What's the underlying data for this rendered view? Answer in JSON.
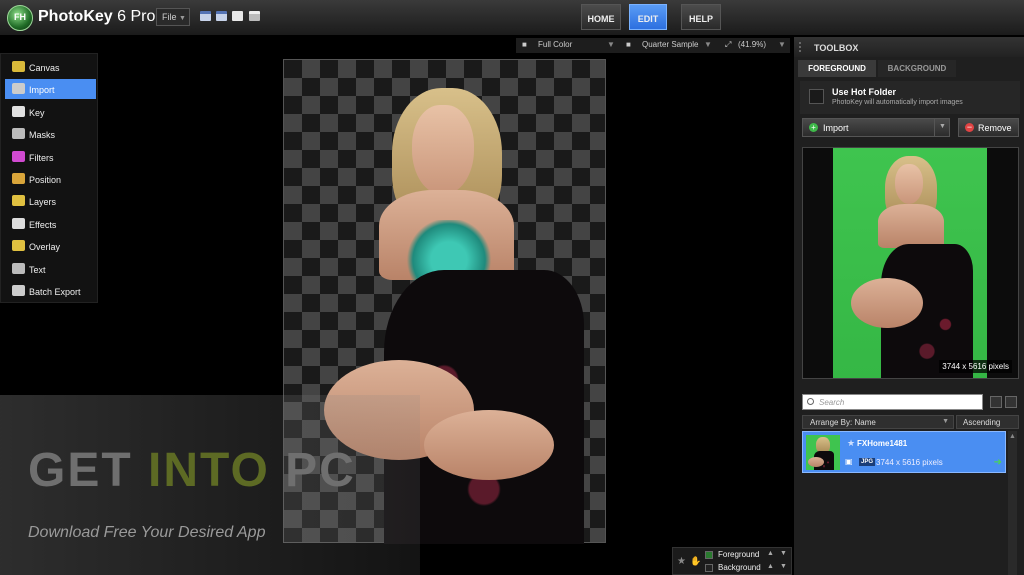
{
  "app": {
    "name": "PhotoKey",
    "version": "6 Pro",
    "logo_text": "FH"
  },
  "menu": {
    "file_label": "File"
  },
  "nav": {
    "tabs": [
      "HOME",
      "EDIT",
      "HELP"
    ],
    "active": "EDIT"
  },
  "tools": [
    {
      "label": "Canvas",
      "icon": "canvas-icon",
      "color": "#d9b93a"
    },
    {
      "label": "Import",
      "icon": "import-icon",
      "color": "#cccccc"
    },
    {
      "label": "Key",
      "icon": "key-icon",
      "color": "#e0e0e0"
    },
    {
      "label": "Masks",
      "icon": "masks-icon",
      "color": "#bbbbbb"
    },
    {
      "label": "Filters",
      "icon": "filters-icon",
      "color": "#d04ad0"
    },
    {
      "label": "Position",
      "icon": "position-icon",
      "color": "#d9a53a"
    },
    {
      "label": "Layers",
      "icon": "layers-icon",
      "color": "#e0c040"
    },
    {
      "label": "Effects",
      "icon": "effects-icon",
      "color": "#dddddd"
    },
    {
      "label": "Overlay",
      "icon": "overlay-icon",
      "color": "#e0c040"
    },
    {
      "label": "Text",
      "icon": "text-icon",
      "color": "#bbbbbb"
    },
    {
      "label": "Batch Export",
      "icon": "batch-export-icon",
      "color": "#cccccc"
    }
  ],
  "active_tool": "Import",
  "canvas_bar": {
    "color_mode": "Full Color",
    "sample": "Quarter Sample",
    "zoom": "(41.9%)"
  },
  "watermark": {
    "title_g": "GET ",
    "title_i": "INTO ",
    "title_p": "PC",
    "subtitle": "Download Free Your Desired App"
  },
  "layers": {
    "fg_label": "Foreground",
    "bg_label": "Background"
  },
  "toolbox": {
    "title": "TOOLBOX",
    "tabs": [
      "FOREGROUND",
      "BACKGROUND"
    ],
    "hot_folder_title": "Use Hot Folder",
    "hot_folder_desc": "PhotoKey will automatically import images",
    "import_label": "Import",
    "remove_label": "Remove",
    "preview_dims": "3744 x 5616 pixels",
    "search_placeholder": "Search",
    "arrange_label": "Arrange By: Name",
    "order_label": "Ascending",
    "file": {
      "name": "FXHome1481",
      "type": "JPG",
      "dims": "3744 x 5616 pixels"
    }
  }
}
